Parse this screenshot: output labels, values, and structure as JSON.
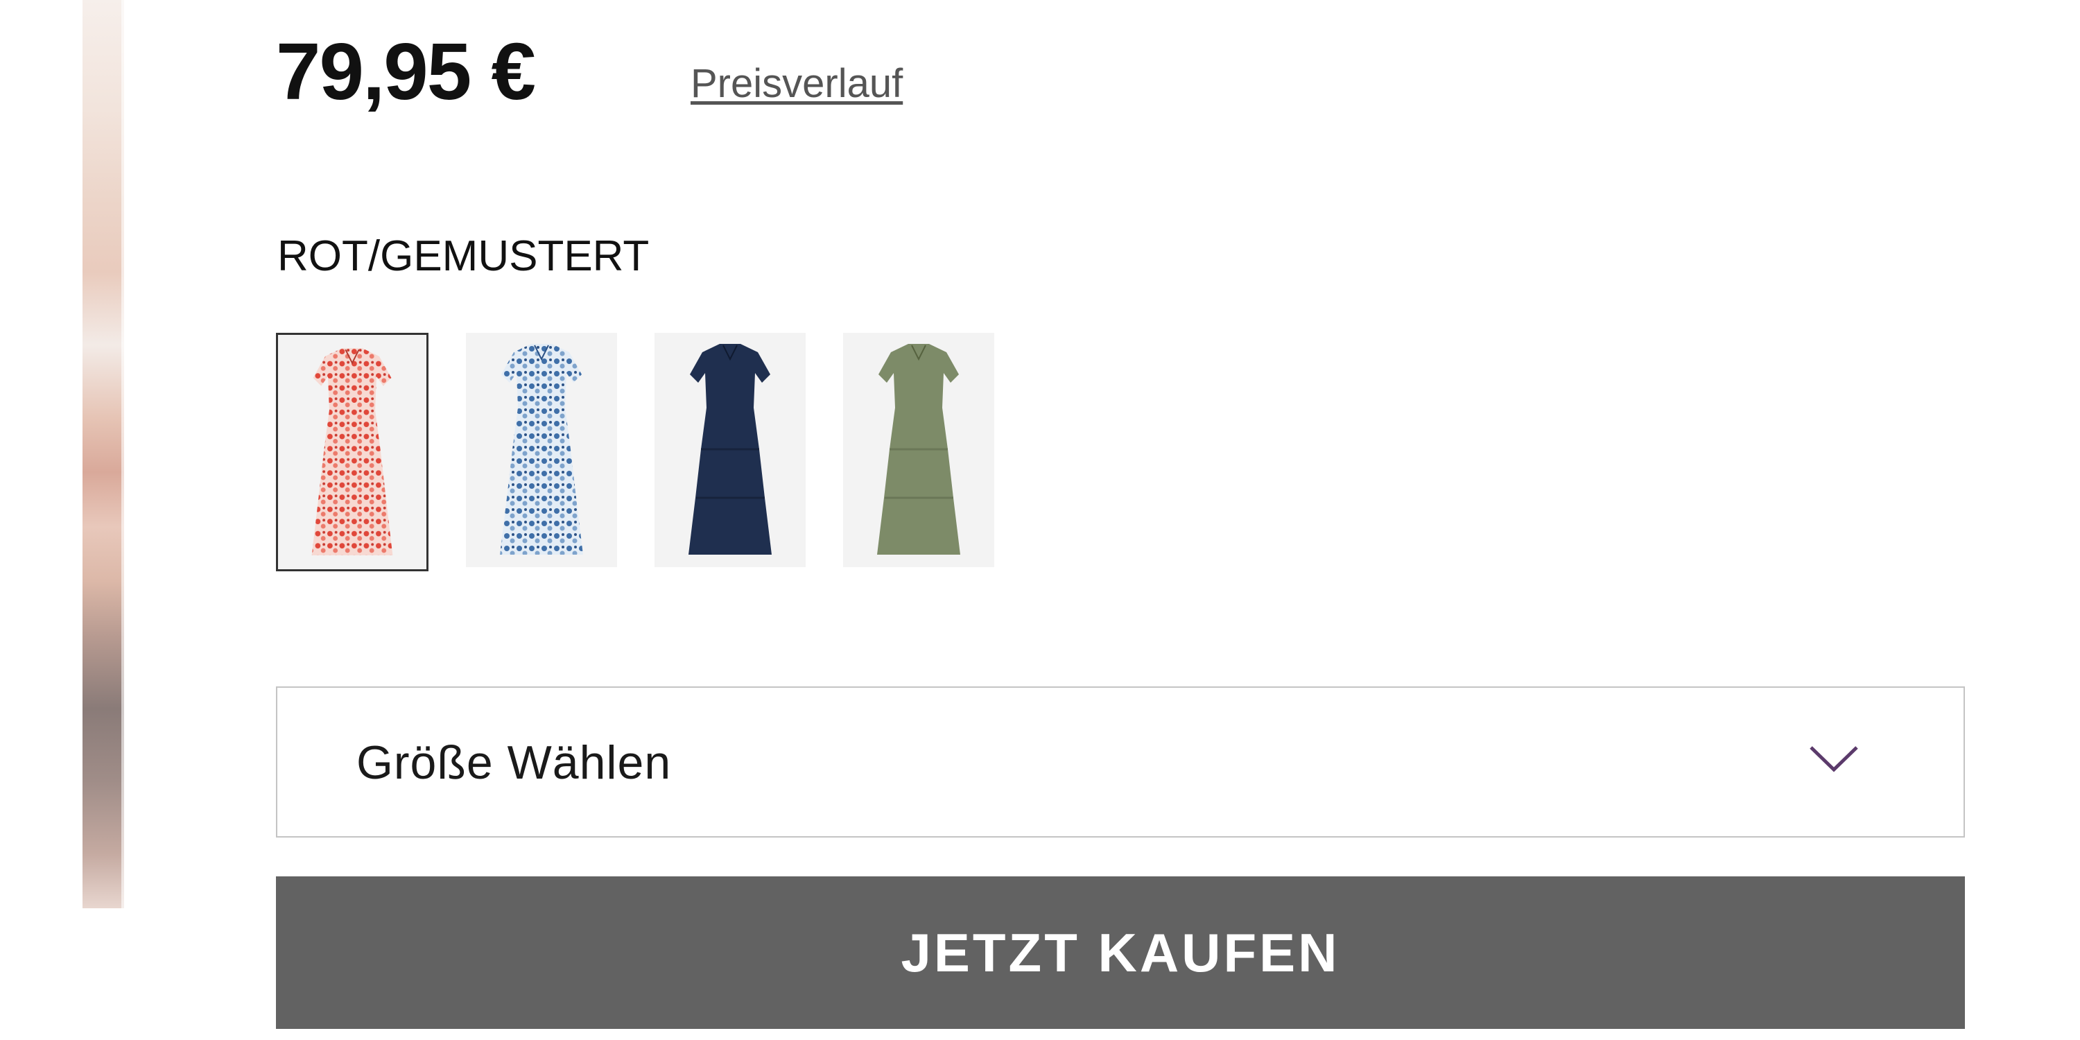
{
  "product": {
    "price": "79,95 €",
    "price_history_link": "Preisverlauf",
    "selected_color": "ROT/GEMUSTERT"
  },
  "swatches": [
    {
      "color_name": "rot/gemustert",
      "dress_color": "#e86a5e",
      "pattern": "floral-red",
      "selected": true
    },
    {
      "color_name": "blau/gemustert",
      "dress_color": "#8fb2d6",
      "pattern": "floral-blue",
      "selected": false
    },
    {
      "color_name": "marine",
      "dress_color": "#1f2f4f",
      "pattern": "solid",
      "selected": false
    },
    {
      "color_name": "khaki",
      "dress_color": "#7d8b68",
      "pattern": "solid",
      "selected": false
    }
  ],
  "size_select": {
    "label": "Größe Wählen",
    "chevron_icon": "chevron-down-icon",
    "chevron_color": "#5b3a6b"
  },
  "buy_button": {
    "label": "JETZT KAUFEN",
    "background": "#626262"
  }
}
